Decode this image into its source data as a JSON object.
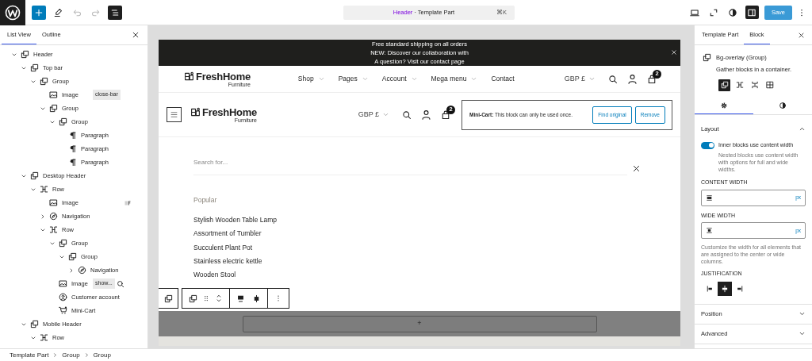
{
  "top_bar": {
    "tools": [
      {
        "kind": "add",
        "selected": false
      },
      {
        "kind": "edit",
        "selected": false
      },
      {
        "kind": "undo",
        "selected": false,
        "disabled": true
      },
      {
        "kind": "redo",
        "selected": false,
        "disabled": true
      },
      {
        "kind": "list",
        "selected": true
      }
    ],
    "command": {
      "title": "Header",
      "detail": "· Template Part",
      "shortcut": "⌘K"
    },
    "actions": [
      {
        "kind": "desktop",
        "selected": false
      },
      {
        "kind": "expand",
        "selected": false
      },
      {
        "kind": "styles",
        "selected": false
      },
      {
        "kind": "sidebar",
        "selected": true
      }
    ],
    "save": {
      "label": "Save",
      "disabled": true
    }
  },
  "list_panel": {
    "tabs": [
      {
        "label": "List View",
        "selected": true
      },
      {
        "label": "Outline",
        "selected": false
      }
    ],
    "tree": [
      {
        "label": "Header",
        "kind": "group",
        "expanded": true,
        "children": [
          {
            "label": "Top bar",
            "kind": "group",
            "expanded": true,
            "children": [
              {
                "label": "Group",
                "kind": "group",
                "expanded": true,
                "children": [
                  {
                    "label": "Image",
                    "kind": "image",
                    "badge": {
                      "kind": "text",
                      "text": "close-bar"
                    }
                  },
                  {
                    "label": "Group",
                    "kind": "group",
                    "expanded": true,
                    "children": [
                      {
                        "label": "Group",
                        "kind": "group",
                        "expanded": true,
                        "children": [
                          {
                            "label": "Paragraph",
                            "kind": "paragraph"
                          },
                          {
                            "label": "Paragraph",
                            "kind": "paragraph"
                          },
                          {
                            "label": "Paragraph",
                            "kind": "paragraph"
                          }
                        ]
                      }
                    ]
                  }
                ]
              }
            ]
          },
          {
            "label": "Desktop Header",
            "kind": "group",
            "expanded": true,
            "children": [
              {
                "label": "Row",
                "kind": "row",
                "expanded": true,
                "children": [
                  {
                    "label": "Image",
                    "kind": "image",
                    "badge": {
                      "kind": "thumbnail"
                    }
                  },
                  {
                    "label": "Navigation",
                    "kind": "navigation",
                    "expanded": false
                  },
                  {
                    "label": "Row",
                    "kind": "row",
                    "expanded": true,
                    "children": [
                      {
                        "label": "Group",
                        "kind": "group",
                        "expanded": true,
                        "children": [
                          {
                            "label": "Group",
                            "kind": "group",
                            "expanded": true,
                            "children": [
                              {
                                "label": "Navigation",
                                "kind": "navigation",
                                "expanded": false
                              }
                            ]
                          }
                        ]
                      },
                      {
                        "label": "Image",
                        "kind": "image",
                        "badge": {
                          "kind": "text_search",
                          "text": "show..."
                        }
                      },
                      {
                        "label": "Customer account",
                        "kind": "account"
                      },
                      {
                        "label": "Mini-Cart",
                        "kind": "cart"
                      }
                    ]
                  }
                ]
              }
            ]
          },
          {
            "label": "Mobile Header",
            "kind": "group",
            "expanded": true,
            "children": [
              {
                "label": "Row",
                "kind": "row",
                "expanded": true
              }
            ]
          }
        ]
      }
    ]
  },
  "canvas": {
    "notice": {
      "lines": [
        "Free standard shipping on all orders",
        "NEW: Discover our collaboration with",
        "A question? Visit our contact page"
      ]
    },
    "desktop_header": {
      "logo": {
        "name": "FreshHome",
        "tagline": "Furniture"
      },
      "nav": [
        {
          "label": "Shop",
          "has_submenu": true
        },
        {
          "label": "Pages",
          "has_submenu": true
        },
        {
          "label": "Account",
          "has_submenu": true
        },
        {
          "label": "Mega menu",
          "has_submenu": true
        },
        {
          "label": "Contact",
          "has_submenu": false
        }
      ],
      "currency": "GBP £",
      "cart_count": "2"
    },
    "mobile_header": {
      "logo": {
        "name": "FreshHome",
        "tagline": "Furniture"
      },
      "currency": "GBP £",
      "cart_count": "2",
      "warning": {
        "message": "**Mini-Cart:** This block can only be used once.",
        "buttons": [
          "Find original",
          "Remove"
        ]
      }
    },
    "search": {
      "placeholder": "Search for...",
      "popular_title": "Popular",
      "popular": [
        "Stylish Wooden Table Lamp",
        "Assortment of Tumbler",
        "Succulent Plant Pot",
        "Stainless electric kettle",
        "Wooden Stool"
      ]
    },
    "appender": "+"
  },
  "settings_panel": {
    "tabs": [
      {
        "label": "Template Part",
        "selected": false
      },
      {
        "label": "Block",
        "selected": true
      }
    ],
    "block": {
      "title": "Bg-overlay (Group)",
      "description": "Gather blocks in a container.",
      "variations": [
        {
          "kind": "group",
          "selected": true
        },
        {
          "kind": "row",
          "selected": false
        },
        {
          "kind": "stack",
          "selected": false
        },
        {
          "kind": "grid",
          "selected": false
        }
      ]
    },
    "subtabs": [
      {
        "kind": "settings",
        "selected": true
      },
      {
        "kind": "styles",
        "selected": false
      }
    ],
    "layout": {
      "title": "Layout",
      "expanded": true,
      "toggle": {
        "label": "Inner blocks use content width",
        "on": true,
        "help": "Nested blocks use content width with options for full and wide widths."
      },
      "fields": [
        {
          "label": "CONTENT WIDTH",
          "kind": "content",
          "unit": "px"
        },
        {
          "label": "WIDE WIDTH",
          "kind": "wide",
          "unit": "px"
        }
      ],
      "help": "Customize the width for all elements that are assigned to the center or wide columns.",
      "justification": {
        "label": "JUSTIFICATION",
        "options": [
          {
            "kind": "left",
            "selected": false
          },
          {
            "kind": "center",
            "selected": true
          },
          {
            "kind": "right",
            "selected": false
          }
        ]
      }
    },
    "sections": [
      {
        "title": "Position",
        "expanded": false
      },
      {
        "title": "Advanced",
        "expanded": false
      }
    ]
  },
  "breadcrumb": [
    "Template Part",
    "Group",
    "Group"
  ]
}
